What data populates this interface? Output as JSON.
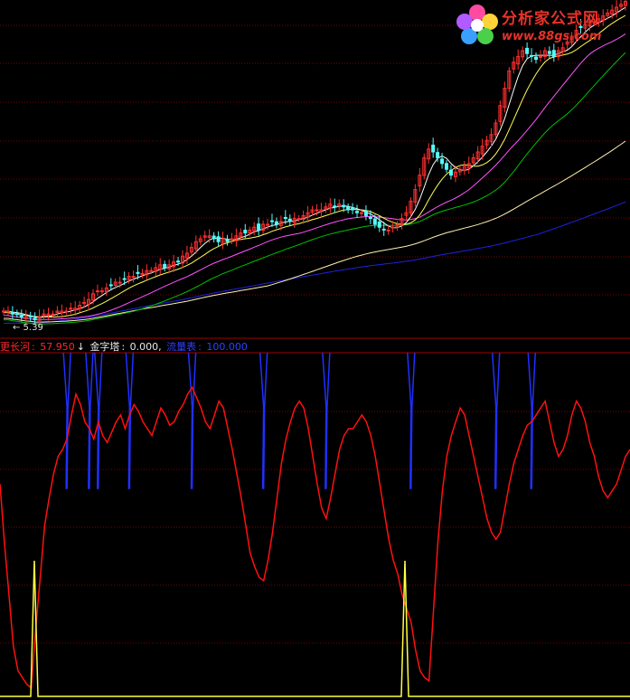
{
  "logo": {
    "name": "分析家公式网",
    "url": "www.88gs.com"
  },
  "upper_panel": {
    "min_price_label": "← 5.39"
  },
  "indicator_legend": {
    "items": [
      {
        "label": "更长河",
        "value": "57.950",
        "arrow": "↓",
        "color": "#ff2a2a"
      },
      {
        "label": "金字塔",
        "value": "0.000,",
        "arrow": "",
        "color": "#e8e8e8"
      },
      {
        "label": "流量表",
        "value": "100.000",
        "arrow": "",
        "color": "#2b2bff"
      }
    ]
  },
  "colors": {
    "background": "#000000",
    "grid": "#7a0000",
    "candle_up": "#ff3030",
    "candle_down": "#54fcfc",
    "ma5": "#ffffff",
    "ma10": "#ffff54",
    "ma20": "#ff54ff",
    "ma30": "#00c000",
    "ma60": "#fff0b0",
    "ma120": "#2020e0",
    "river_line": "#ff1010",
    "pyramid_line": "#ffff40",
    "flow_line": "#2030ff"
  },
  "chart_data": [
    {
      "type": "line",
      "panel": "price",
      "description_values": "normalized price level 0-1 across panel height",
      "n": 140,
      "close": [
        0.05,
        0.05,
        0.04,
        0.04,
        0.03,
        0.03,
        0.03,
        0.02,
        0.03,
        0.04,
        0.04,
        0.04,
        0.05,
        0.05,
        0.05,
        0.06,
        0.06,
        0.07,
        0.08,
        0.09,
        0.11,
        0.12,
        0.12,
        0.13,
        0.14,
        0.15,
        0.15,
        0.16,
        0.17,
        0.17,
        0.18,
        0.18,
        0.19,
        0.19,
        0.2,
        0.21,
        0.2,
        0.21,
        0.22,
        0.22,
        0.24,
        0.25,
        0.27,
        0.29,
        0.3,
        0.31,
        0.31,
        0.3,
        0.29,
        0.3,
        0.29,
        0.3,
        0.31,
        0.32,
        0.32,
        0.33,
        0.34,
        0.33,
        0.35,
        0.35,
        0.36,
        0.35,
        0.36,
        0.37,
        0.36,
        0.37,
        0.37,
        0.38,
        0.39,
        0.4,
        0.4,
        0.4,
        0.41,
        0.42,
        0.41,
        0.42,
        0.41,
        0.4,
        0.4,
        0.39,
        0.39,
        0.38,
        0.37,
        0.35,
        0.34,
        0.33,
        0.33,
        0.34,
        0.35,
        0.37,
        0.39,
        0.43,
        0.47,
        0.52,
        0.58,
        0.61,
        0.6,
        0.58,
        0.56,
        0.54,
        0.52,
        0.53,
        0.54,
        0.55,
        0.56,
        0.58,
        0.6,
        0.62,
        0.64,
        0.66,
        0.7,
        0.76,
        0.82,
        0.88,
        0.91,
        0.93,
        0.95,
        0.94,
        0.93,
        0.92,
        0.93,
        0.95,
        0.94,
        0.93,
        0.95,
        0.96,
        0.98,
        1.0,
        1.02,
        1.03,
        1.04,
        1.05,
        1.05,
        1.06,
        1.07,
        1.08,
        1.09,
        1.1,
        1.11,
        1.12
      ]
    },
    {
      "type": "line",
      "panel": "indicator",
      "series": [
        {
          "name": "更长河",
          "color": "#ff1010"
        },
        {
          "name": "金字塔",
          "color": "#ffff40"
        },
        {
          "name": "流量表",
          "color": "#2030ff"
        }
      ],
      "ylim": [
        0,
        100
      ],
      "river": [
        62,
        45,
        30,
        15,
        8,
        6,
        4,
        3,
        20,
        35,
        50,
        58,
        65,
        70,
        72,
        75,
        82,
        88,
        85,
        80,
        78,
        75,
        80,
        76,
        74,
        77,
        80,
        82,
        78,
        82,
        85,
        83,
        80,
        78,
        76,
        80,
        84,
        82,
        79,
        80,
        83,
        85,
        88,
        90,
        87,
        84,
        80,
        78,
        82,
        86,
        84,
        78,
        72,
        65,
        58,
        50,
        42,
        38,
        35,
        34,
        40,
        48,
        58,
        68,
        75,
        80,
        84,
        86,
        84,
        78,
        70,
        62,
        55,
        52,
        58,
        65,
        72,
        76,
        78,
        78,
        80,
        82,
        80,
        76,
        70,
        62,
        54,
        46,
        40,
        36,
        30,
        26,
        22,
        14,
        8,
        6,
        5,
        25,
        45,
        60,
        70,
        76,
        80,
        84,
        82,
        76,
        70,
        64,
        58,
        52,
        48,
        46,
        48,
        55,
        62,
        68,
        72,
        76,
        79,
        80,
        82,
        84,
        86,
        80,
        74,
        70,
        72,
        76,
        82,
        86,
        84,
        80,
        74,
        70,
        64,
        60,
        58,
        60,
        62,
        66,
        70,
        72
      ]
    }
  ]
}
